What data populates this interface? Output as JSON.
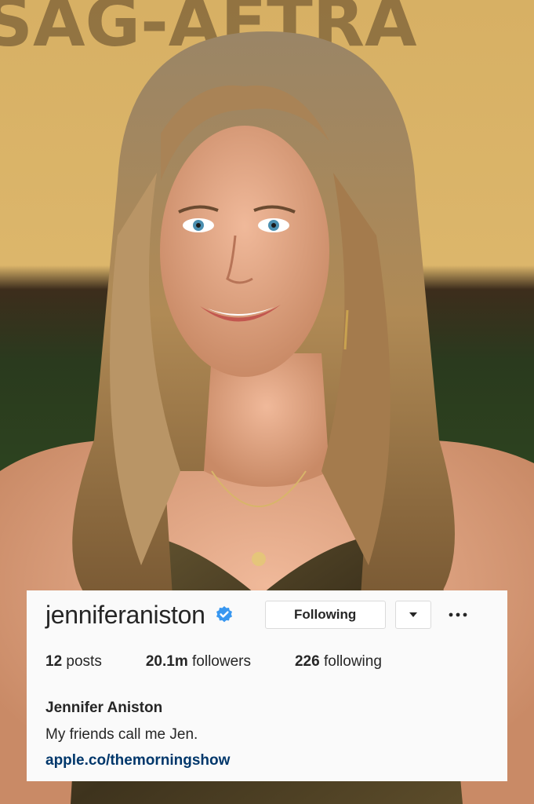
{
  "photo": {
    "backdrop_text": "SAG-AFTRA",
    "accent_colors": {
      "backdrop": "#d9b267",
      "hair": "#a07a4a",
      "skin": "#e2a680",
      "dress": "#5a4a2a"
    }
  },
  "profile": {
    "username": "jenniferaniston",
    "verified_icon": "verified-badge-icon",
    "verified_color": "#3897f0",
    "following_button_label": "Following",
    "dropdown_icon": "caret-down-icon",
    "more_icon": "more-options-icon",
    "stats": {
      "posts_count": "12",
      "posts_label": "posts",
      "followers_count": "20.1m",
      "followers_label": "followers",
      "following_count": "226",
      "following_label": "following"
    },
    "full_name": "Jennifer Aniston",
    "bio": "My friends call me Jen.",
    "website": "apple.co/themorningshow",
    "link_color": "#00376b"
  }
}
